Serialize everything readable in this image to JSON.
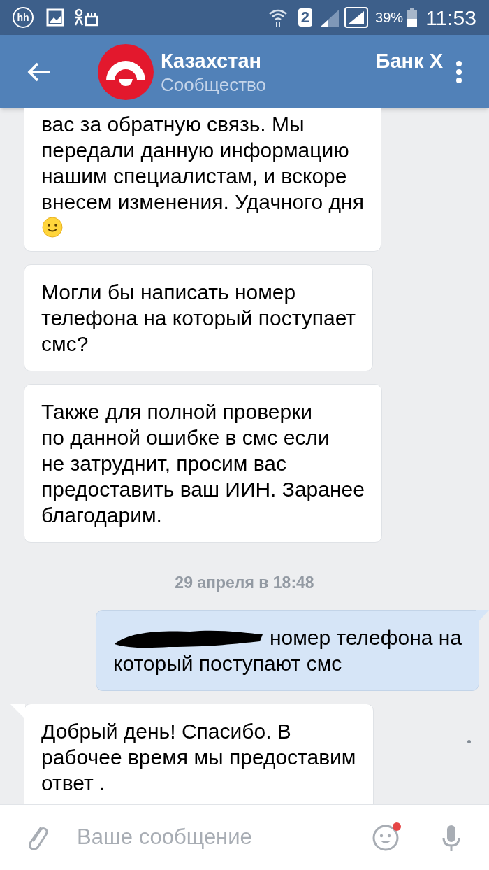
{
  "status_bar": {
    "hh": "hh",
    "sim": "2",
    "battery": "39%",
    "time": "11:53"
  },
  "header": {
    "title": "Казахстан",
    "title_end": "Банк Х",
    "subtitle": "Сообщество"
  },
  "messages": [
    {
      "kind": "in",
      "cut_top": true,
      "emoji": true,
      "tail": false,
      "redacted": false,
      "unread": false,
      "text": "вас за обратную связь. Мы\nпередали данную информацию\nнашим специалистам, и вскоре\nвнесем изменения. Удачного дня"
    },
    {
      "kind": "in",
      "cut_top": false,
      "emoji": false,
      "tail": false,
      "redacted": false,
      "unread": false,
      "text": "Могли бы написать номер\nтелефона на который поступает\nсмс?"
    },
    {
      "kind": "in",
      "cut_top": false,
      "emoji": false,
      "tail": false,
      "redacted": false,
      "unread": false,
      "text": "Также для полной проверки\nпо данной ошибке в смс если\nне затруднит, просим вас\nпредоставить ваш ИИН. Заранее\nблагодарим."
    },
    {
      "kind": "date",
      "text": "29 апреля в 18:48"
    },
    {
      "kind": "out",
      "cut_top": false,
      "emoji": false,
      "tail": true,
      "redacted": true,
      "unread": false,
      "text": "номер телефона на\nкоторый поступают смс"
    },
    {
      "kind": "in",
      "cut_top": false,
      "emoji": false,
      "tail": true,
      "redacted": false,
      "unread": true,
      "text": "Добрый день! Спасибо. В\nрабочее время мы предоставим\nответ ."
    }
  ],
  "composer": {
    "placeholder": "Ваше сообщение",
    "emoji_badge": true
  }
}
